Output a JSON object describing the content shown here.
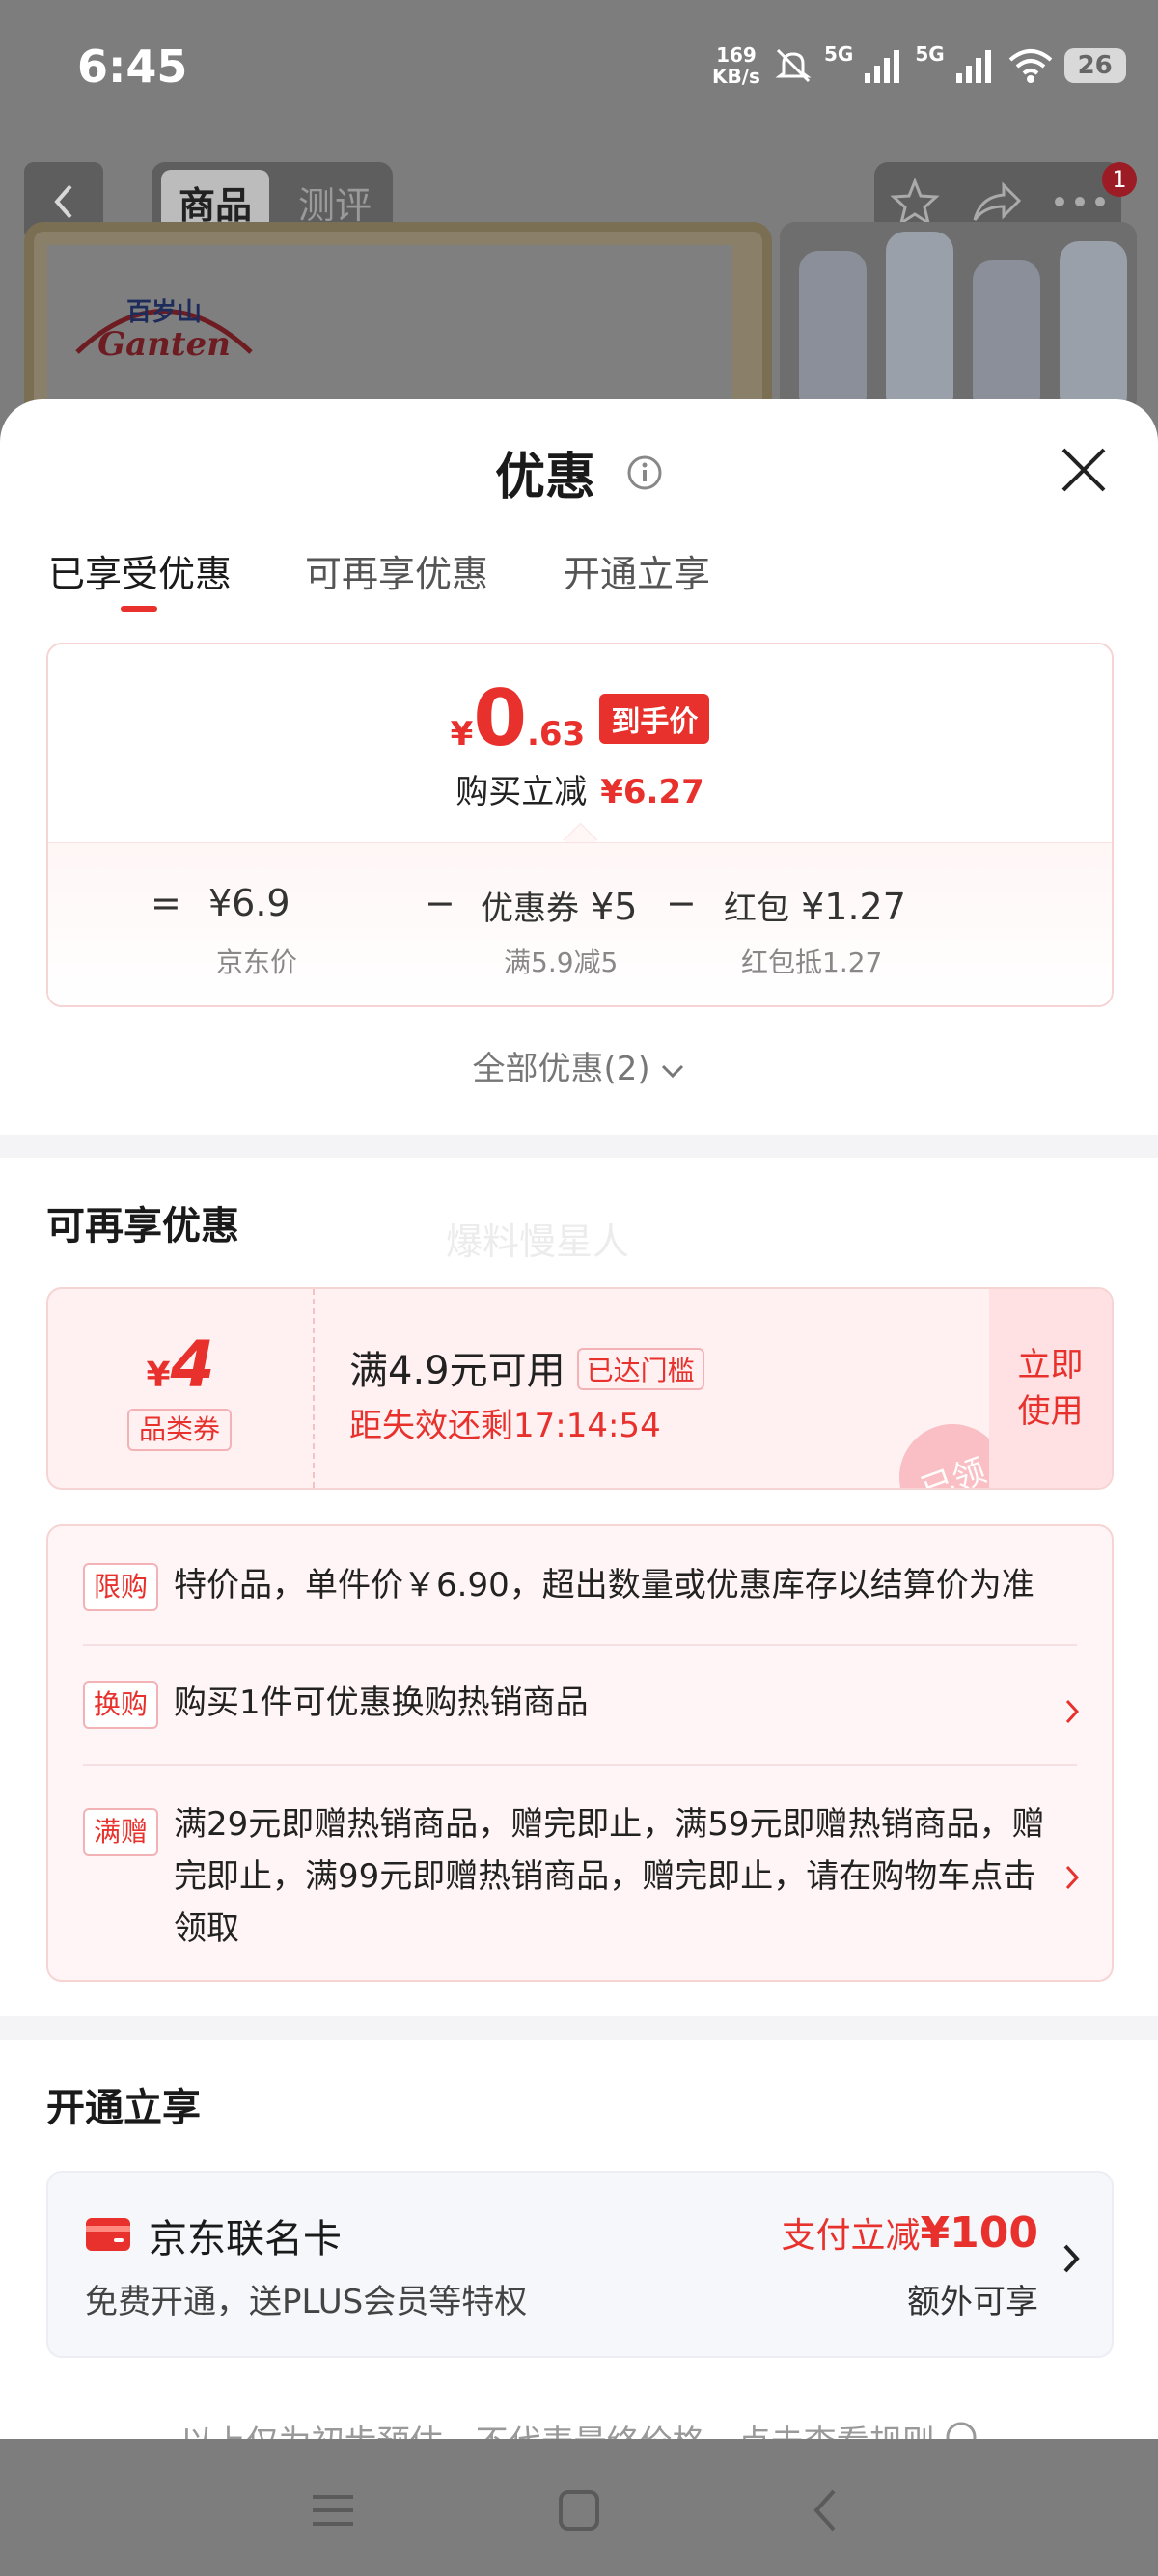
{
  "status_bar": {
    "time": "6:45",
    "net_speed_value": "169",
    "net_speed_unit": "KB/s",
    "signal_1": "5G",
    "signal_2": "5G",
    "battery": "26",
    "icons": [
      "mute-icon",
      "signal-icon",
      "wifi-icon",
      "battery-icon"
    ]
  },
  "product_header": {
    "tabs": [
      {
        "label": "商品",
        "active": true
      },
      {
        "label": "测评",
        "active": false
      }
    ],
    "cart_badge": "1",
    "icons": [
      "back-icon",
      "star-icon",
      "share-icon",
      "more-icon"
    ]
  },
  "sheet": {
    "title": "优惠",
    "tabs": [
      {
        "label": "已享受优惠",
        "active": true
      },
      {
        "label": "可再享优惠",
        "active": false
      },
      {
        "label": "开通立享",
        "active": false
      }
    ],
    "price_card": {
      "currency": "¥",
      "price_int": "0",
      "price_dec": ".63",
      "final_tag": "到手价",
      "save_label": "购买立减",
      "save_amount": "¥6.27",
      "calc": {
        "equals": "=",
        "base_price": "¥6.9",
        "base_label": "京东价",
        "minus": "−",
        "coupon_label": "优惠券",
        "coupon_amount": "¥5",
        "coupon_desc": "满5.9减5",
        "redpack_label": "红包",
        "redpack_amount": "¥1.27",
        "redpack_desc": "红包抵1.27"
      }
    },
    "all_offers": "全部优惠(2)",
    "more_section": {
      "title": "可再享优惠",
      "watermark": "爆料慢星人",
      "coupon": {
        "currency": "¥",
        "amount": "4",
        "type": "品类券",
        "condition": "满4.9元可用",
        "reached_tag": "已达门槛",
        "expire": "距失效还剩17:14:54",
        "use_label_1": "立即",
        "use_label_2": "使用",
        "stamp": "已领"
      },
      "promos": [
        {
          "tag": "限购",
          "text": "特价品，单件价￥6.90，超出数量或优惠库存以结算价为准",
          "has_arrow": false
        },
        {
          "tag": "换购",
          "text": "购买1件可优惠换购热销商品",
          "has_arrow": true
        },
        {
          "tag": "满赠",
          "text": "满29元即赠热销商品，赠完即止，满59元即赠热销商品，赠完即止，满99元即赠热销商品，赠完即止，请在购物车点击领取",
          "has_arrow": true
        }
      ]
    },
    "open_section": {
      "title": "开通立享",
      "card": {
        "name": "京东联名卡",
        "desc": "免费开通，送PLUS会员等特权",
        "discount_label": "支付立减",
        "discount_amount": "¥100",
        "extra": "额外可享"
      }
    },
    "footnote": "以上仅为初步预估，不代表最终价格，点击查看规则"
  },
  "colors": {
    "accent_red": "#e8312c",
    "card_border": "#f7d4d4",
    "overlay": "#7d7d7d"
  }
}
